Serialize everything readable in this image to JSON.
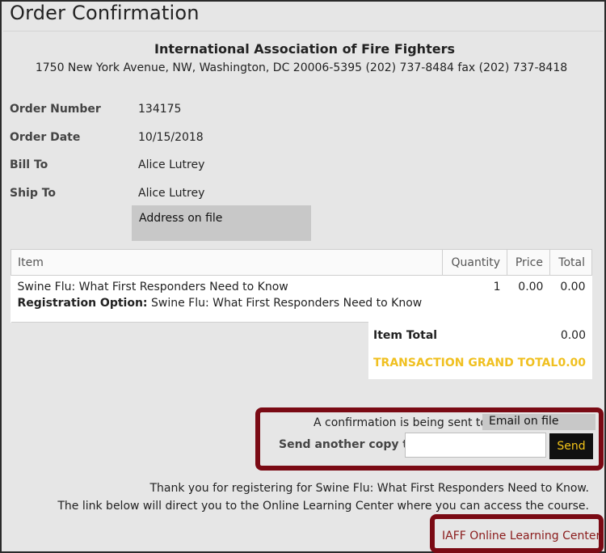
{
  "page": {
    "title": "Order Confirmation"
  },
  "org": {
    "name": "International Association of Fire Fighters",
    "address": "1750 New York Avenue, NW, Washington, DC 20006-5395 (202) 737-8484 fax (202) 737-8418"
  },
  "order": {
    "number_label": "Order Number",
    "number": "134175",
    "date_label": "Order Date",
    "date": "10/15/2018",
    "bill_to_label": "Bill To",
    "bill_to": "Alice Lutrey",
    "ship_to_label": "Ship To",
    "ship_to": "Alice Lutrey",
    "address_placeholder": "Address on file"
  },
  "items_table": {
    "headers": {
      "item": "Item",
      "quantity": "Quantity",
      "price": "Price",
      "total": "Total"
    },
    "rows": [
      {
        "item": "Swine Flu: What First Responders Need to Know",
        "registration_label": "Registration Option:",
        "registration_value": "Swine Flu: What First Responders Need to Know",
        "quantity": "1",
        "price": "0.00",
        "total": "0.00"
      }
    ]
  },
  "totals": {
    "item_total_label": "Item Total",
    "item_total": "0.00",
    "grand_total_label": "TRANSACTION GRAND TOTAL",
    "grand_total": "0.00"
  },
  "confirmation": {
    "sent_to_text": "A confirmation is being sent to:",
    "email_placeholder": "Email on file",
    "send_another_label": "Send another copy to:",
    "send_input_value": "",
    "send_button_label": "Send"
  },
  "thanks": {
    "line1": "Thank you for registering for Swine Flu: What First Responders Need to Know.",
    "line2": "The link below will direct you to the Online Learning Center where you can access the course."
  },
  "link": {
    "label": "IAFF Online Learning Center"
  },
  "colors": {
    "highlight_border": "#7a0a14",
    "grand_total": "#f0c020",
    "send_text": "#f5c518"
  }
}
